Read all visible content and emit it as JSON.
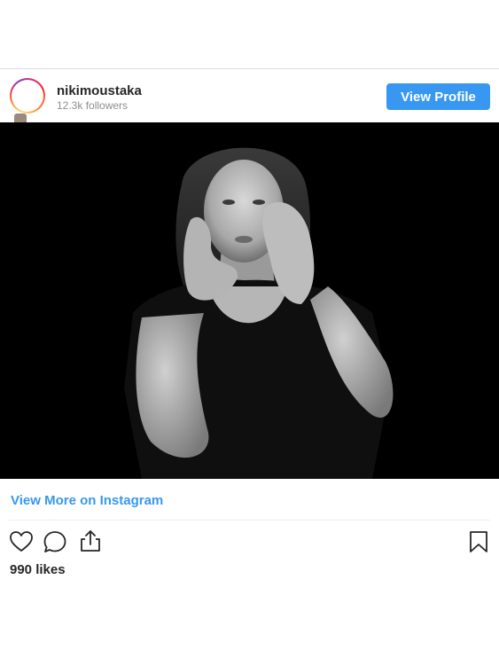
{
  "profile": {
    "username": "nikimoustaka",
    "followers": "12.3k followers",
    "view_profile_label": "View Profile"
  },
  "post": {
    "image_alt": "Black and white portrait of a woman with hands framing her face",
    "view_more_label": "View More on Instagram",
    "likes": "990 likes"
  },
  "icons": {
    "like": "heart-icon",
    "comment": "comment-icon",
    "share": "share-icon",
    "save": "bookmark-icon"
  },
  "colors": {
    "accent": "#3897f0",
    "text": "#262626",
    "muted": "#8e8e8e"
  }
}
